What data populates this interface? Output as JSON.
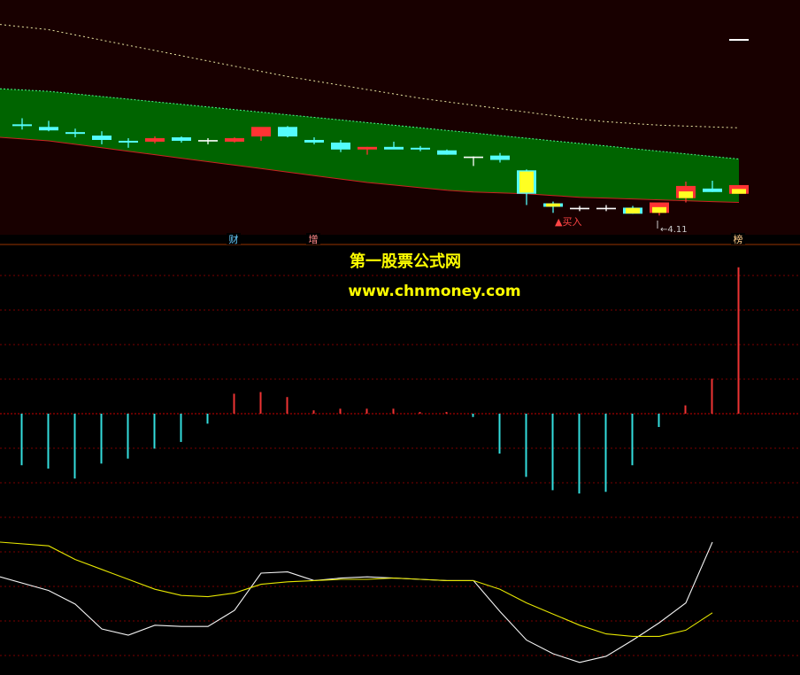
{
  "colors": {
    "up": "#ff3333",
    "down": "#54fcfc",
    "band": "#006400",
    "band_edge_top": "#44ff88",
    "band_edge_bottom": "#cc2222",
    "upper_dotted": "#e8e4a0",
    "highlight": "#ffff22",
    "price_bg": "#180000",
    "bar_pos": "#ee3333",
    "bar_neg": "#33dddd",
    "grid": "#7a0000",
    "line_white": "#f4f4f4",
    "line_yellow": "#e6e600"
  },
  "watermark": {
    "title": "第一股票公式网",
    "url": "www.chnmoney.com"
  },
  "markers": {
    "buy_label": "▲买入",
    "price_label": "4.11",
    "tag_cai": "财",
    "tag_zeng": "增",
    "tag_end": "榜"
  },
  "chart_data": [
    {
      "type": "candlestick",
      "panel": "price",
      "candles": [
        {
          "o": 5.27,
          "h": 5.34,
          "l": 5.21,
          "c": 5.25
        },
        {
          "o": 5.24,
          "h": 5.31,
          "l": 5.19,
          "c": 5.2
        },
        {
          "o": 5.18,
          "h": 5.22,
          "l": 5.12,
          "c": 5.16
        },
        {
          "o": 5.14,
          "h": 5.19,
          "l": 5.04,
          "c": 5.09
        },
        {
          "o": 5.08,
          "h": 5.11,
          "l": 5.0,
          "c": 5.06
        },
        {
          "o": 5.07,
          "h": 5.13,
          "l": 5.05,
          "c": 5.11
        },
        {
          "o": 5.12,
          "h": 5.13,
          "l": 5.06,
          "c": 5.08
        },
        {
          "o": 5.08,
          "h": 5.11,
          "l": 5.04,
          "c": 5.08
        },
        {
          "o": 5.07,
          "h": 5.12,
          "l": 5.06,
          "c": 5.11
        },
        {
          "o": 5.13,
          "h": 5.23,
          "l": 5.08,
          "c": 5.24
        },
        {
          "o": 5.24,
          "h": 5.25,
          "l": 5.12,
          "c": 5.13
        },
        {
          "o": 5.09,
          "h": 5.12,
          "l": 5.04,
          "c": 5.06
        },
        {
          "o": 5.06,
          "h": 5.09,
          "l": 4.95,
          "c": 4.98
        },
        {
          "o": 4.98,
          "h": 5.01,
          "l": 4.92,
          "c": 5.01
        },
        {
          "o": 5.01,
          "h": 5.07,
          "l": 5.0,
          "c": 4.98
        },
        {
          "o": 5.0,
          "h": 5.02,
          "l": 4.96,
          "c": 4.98
        },
        {
          "o": 4.97,
          "h": 4.98,
          "l": 4.92,
          "c": 4.92
        },
        {
          "o": 4.89,
          "h": 4.9,
          "l": 4.79,
          "c": 4.89
        },
        {
          "o": 4.91,
          "h": 4.94,
          "l": 4.83,
          "c": 4.86
        },
        {
          "o": 4.74,
          "h": 4.75,
          "l": 4.34,
          "c": 4.47
        },
        {
          "o": 4.36,
          "h": 4.38,
          "l": 4.25,
          "c": 4.32
        },
        {
          "o": 4.3,
          "h": 4.33,
          "l": 4.27,
          "c": 4.3
        },
        {
          "o": 4.3,
          "h": 4.34,
          "l": 4.27,
          "c": 4.3
        },
        {
          "o": 4.31,
          "h": 4.33,
          "l": 4.24,
          "c": 4.24
        },
        {
          "o": 4.25,
          "h": 4.37,
          "l": 4.22,
          "c": 4.37
        },
        {
          "o": 4.42,
          "h": 4.61,
          "l": 4.37,
          "c": 4.56
        },
        {
          "o": 4.53,
          "h": 4.62,
          "l": 4.49,
          "c": 4.49
        },
        {
          "o": 4.47,
          "h": 4.57,
          "l": 4.48,
          "c": 4.57
        }
      ],
      "highlighted_candles": [
        19,
        20,
        21,
        22,
        23,
        24,
        25,
        27
      ],
      "band_top": [
        5.68,
        5.65,
        5.62,
        5.59,
        5.56,
        5.53,
        5.5,
        5.47,
        5.44,
        5.41,
        5.38,
        5.35,
        5.32,
        5.29,
        5.26,
        5.23,
        5.2,
        5.17,
        5.14,
        5.11,
        5.08,
        5.05,
        5.02,
        4.99,
        4.96,
        4.93,
        4.9,
        4.87
      ],
      "band_bottom": [
        5.12,
        5.08,
        5.04,
        5.0,
        4.96,
        4.92,
        4.88,
        4.84,
        4.8,
        4.76,
        4.72,
        4.68,
        4.64,
        4.6,
        4.57,
        4.54,
        4.51,
        4.49,
        4.48,
        4.47,
        4.45,
        4.43,
        4.42,
        4.41,
        4.4,
        4.39,
        4.38,
        4.37
      ],
      "upper_line": [
        6.42,
        6.36,
        6.3,
        6.24,
        6.18,
        6.12,
        6.06,
        6.0,
        5.94,
        5.88,
        5.82,
        5.77,
        5.72,
        5.67,
        5.62,
        5.57,
        5.53,
        5.49,
        5.45,
        5.41,
        5.37,
        5.33,
        5.3,
        5.28,
        5.26,
        5.25,
        5.24,
        5.23
      ],
      "buy_index": 20,
      "price_label_index": 24,
      "ylim": [
        4.1,
        6.6
      ]
    },
    {
      "type": "bar",
      "panel": "histogram",
      "values": [
        -0.31,
        -0.33,
        -0.39,
        -0.3,
        -0.27,
        -0.21,
        -0.17,
        -0.06,
        0.12,
        0.13,
        0.1,
        0.02,
        0.03,
        0.03,
        0.03,
        0.01,
        0.01,
        -0.02,
        -0.24,
        -0.38,
        -0.46,
        -0.48,
        -0.47,
        -0.31,
        -0.08,
        0.05,
        0.21,
        0.88
      ],
      "ylim": [
        -0.5,
        0.9
      ]
    },
    {
      "type": "line",
      "panel": "oscillator",
      "series": [
        {
          "values": [
            0.72,
            0.61,
            0.5,
            0.3,
            0.25,
            0.33,
            0.32,
            0.32,
            0.45,
            0.75,
            0.76,
            0.69,
            0.71,
            0.72,
            0.71,
            0.7,
            0.69,
            0.69,
            0.44,
            0.21,
            0.1,
            0.03,
            0.08,
            0.21,
            0.35,
            0.51,
            1.0
          ]
        },
        {
          "values": [
            1.0,
            0.97,
            0.86,
            0.78,
            0.7,
            0.62,
            0.57,
            0.56,
            0.59,
            0.66,
            0.68,
            0.69,
            0.7,
            0.7,
            0.71,
            0.7,
            0.69,
            0.69,
            0.62,
            0.51,
            0.42,
            0.33,
            0.26,
            0.24,
            0.24,
            0.29,
            0.43
          ]
        }
      ],
      "ylim": [
        0.0,
        1.05
      ]
    }
  ]
}
